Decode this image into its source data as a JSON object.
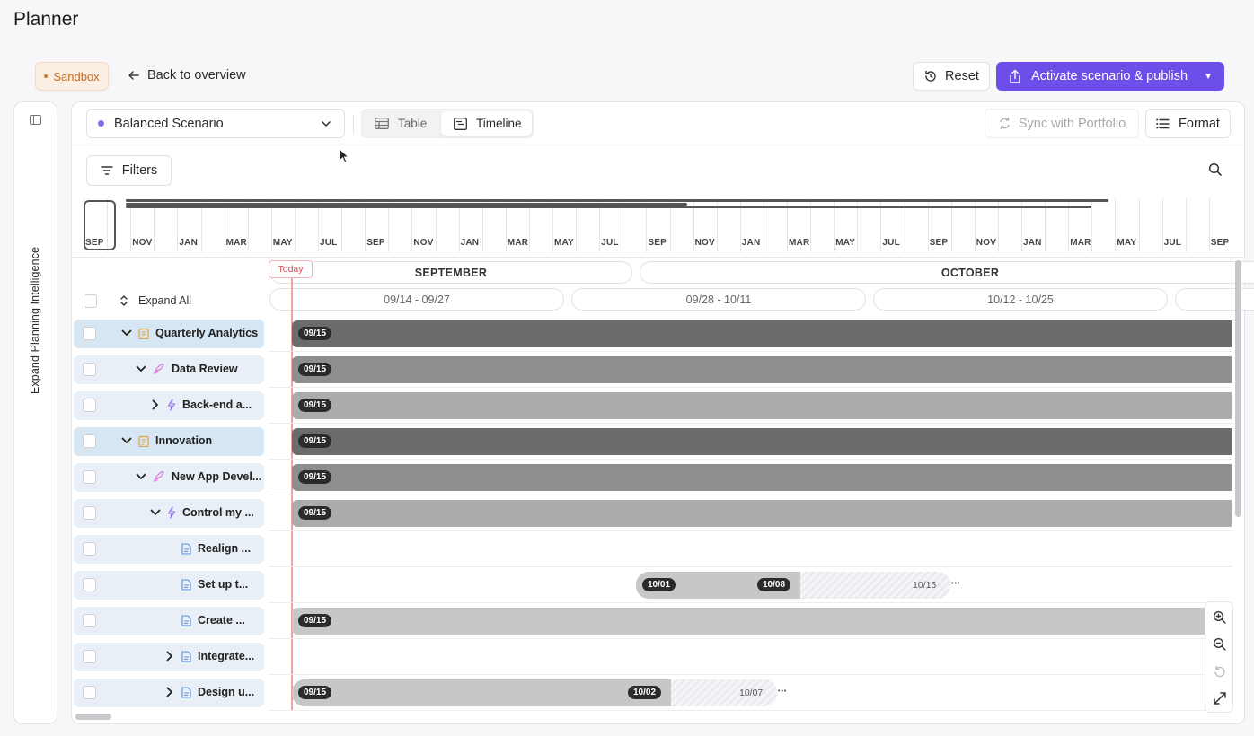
{
  "page": {
    "title": "Planner"
  },
  "header": {
    "sandbox_label": "Sandbox",
    "back_label": "Back to overview",
    "reset_label": "Reset",
    "activate_label": "Activate scenario & publish"
  },
  "sidebar": {
    "expand_label": "Expand Planning Intelligence"
  },
  "toolbar": {
    "scenario": "Balanced Scenario",
    "views": [
      {
        "label": "Table"
      },
      {
        "label": "Timeline"
      }
    ],
    "active_view": "Timeline",
    "sync_label": "Sync with Portfolio",
    "format_label": "Format",
    "filters_label": "Filters"
  },
  "minimap": {
    "labels": [
      "SEP",
      "NOV",
      "JAN",
      "MAR",
      "MAY",
      "JUL",
      "SEP",
      "NOV",
      "JAN",
      "MAR",
      "MAY",
      "JUL",
      "SEP",
      "NOV",
      "JAN",
      "MAR",
      "MAY",
      "JUL",
      "SEP",
      "NOV",
      "JAN",
      "MAR",
      "MAY",
      "JUL",
      "SEP"
    ]
  },
  "timeline": {
    "today_label": "Today",
    "months": [
      "SEPTEMBER",
      "OCTOBER"
    ],
    "weeks": [
      "09/14 - 09/27",
      "09/28 - 10/11",
      "10/12 - 10/25"
    ],
    "expand_all_label": "Expand All"
  },
  "rows": [
    {
      "label": "Quarterly Analytics",
      "level": 0,
      "arrow": "down",
      "icon": "clipboard-icon",
      "selected": true,
      "bar": {
        "start_label": "09/15",
        "color": "#6b6b6b"
      }
    },
    {
      "label": "Data Review",
      "level": 1,
      "arrow": "down",
      "icon": "rocket-icon",
      "bar": {
        "start_label": "09/15",
        "color": "#8e8e8e"
      }
    },
    {
      "label": "Back-end a...",
      "level": 2,
      "arrow": "right",
      "icon": "bolt-icon",
      "bar": {
        "start_label": "09/15",
        "color": "#ababab"
      }
    },
    {
      "label": "Innovation",
      "level": 0,
      "arrow": "down",
      "icon": "clipboard-icon",
      "selected": true,
      "bar": {
        "start_label": "09/15",
        "color": "#6b6b6b"
      }
    },
    {
      "label": "New App Devel...",
      "level": 1,
      "arrow": "down",
      "icon": "rocket-icon",
      "bar": {
        "start_label": "09/15",
        "color": "#8e8e8e"
      }
    },
    {
      "label": "Control my ...",
      "level": 2,
      "arrow": "down",
      "icon": "bolt-icon",
      "bar": {
        "start_label": "09/15",
        "color": "#ababab"
      }
    },
    {
      "label": "Realign ...",
      "level": 3,
      "arrow": "",
      "icon": "document-icon",
      "bar": null
    },
    {
      "label": "Set up t...",
      "level": 3,
      "arrow": "",
      "icon": "document-icon",
      "bar": {
        "start_label": "10/01",
        "mid_label": "10/08",
        "end_label": "10/15",
        "color": "#c7c7c7"
      }
    },
    {
      "label": "Create ...",
      "level": 3,
      "arrow": "",
      "icon": "document-icon",
      "bar": {
        "start_label": "09/15",
        "color": "#c7c7c7"
      }
    },
    {
      "label": "Integrate...",
      "level": 3,
      "arrow": "right",
      "icon": "document-icon",
      "bar": null
    },
    {
      "label": "Design u...",
      "level": 3,
      "arrow": "right",
      "icon": "document-icon",
      "bar": {
        "start_label": "09/15",
        "mid_label": "10/02",
        "end_label": "10/07",
        "color": "#c7c7c7"
      }
    }
  ],
  "colors": {
    "accent": "#6d4ee8",
    "today": "#e0474c",
    "row_selected": "#d6e6f2",
    "row_default": "#e8eff6"
  }
}
